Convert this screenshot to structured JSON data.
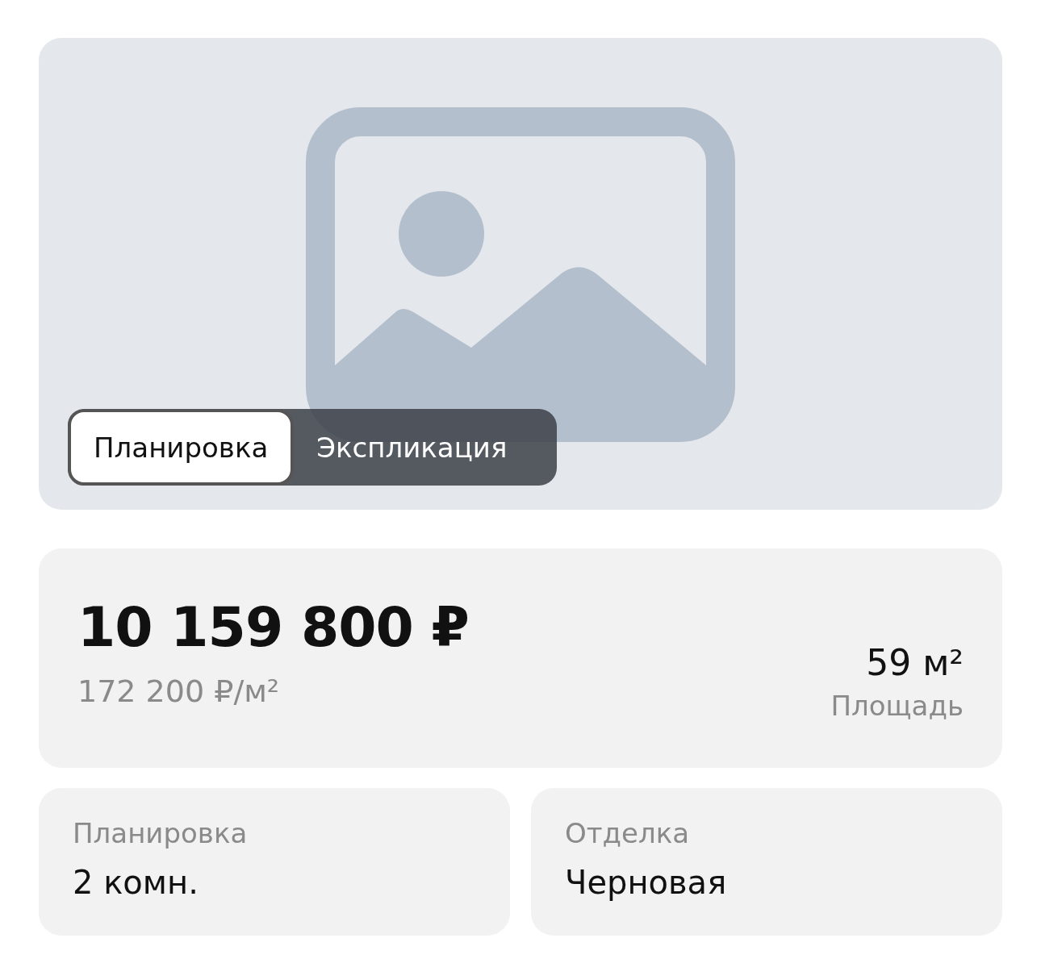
{
  "gallery": {
    "tabs": [
      {
        "label": "Планировка",
        "selected": true
      },
      {
        "label": "Экспликация",
        "selected": false
      }
    ]
  },
  "price": {
    "total": "10 159 800 ₽",
    "per_meter": "172 200 ₽/м²",
    "area": "59 м²",
    "area_label": "Площадь"
  },
  "details": [
    {
      "label": "Планировка",
      "value": "2 комн."
    },
    {
      "label": "Отделка",
      "value": "Черновая"
    }
  ]
}
